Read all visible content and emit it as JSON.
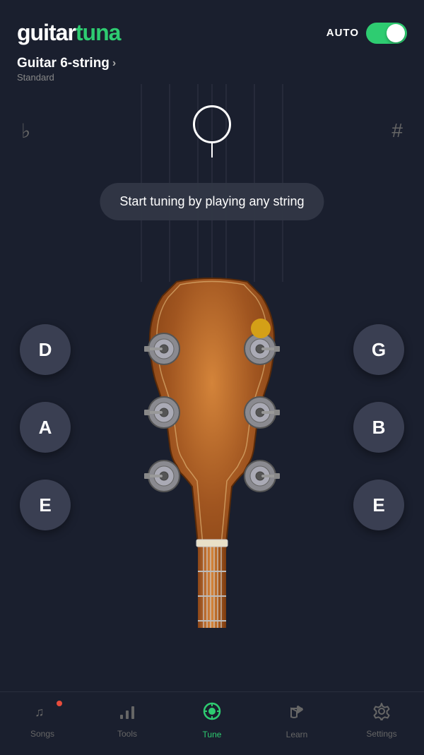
{
  "app": {
    "logo_guitar": "guitar",
    "logo_tuna": "tuna",
    "auto_label": "AUTO",
    "toggle_state": true
  },
  "instrument": {
    "name": "Guitar 6-string",
    "tuning": "Standard",
    "chevron": "›"
  },
  "tuner": {
    "flat_symbol": "♭",
    "sharp_symbol": "#",
    "tooltip": "Start tuning by playing any string"
  },
  "strings": [
    {
      "note": "D",
      "position": "left-top"
    },
    {
      "note": "A",
      "position": "left-mid"
    },
    {
      "note": "E",
      "position": "left-bot"
    },
    {
      "note": "G",
      "position": "right-top"
    },
    {
      "note": "B",
      "position": "right-mid"
    },
    {
      "note": "E",
      "position": "right-bot"
    }
  ],
  "nav": {
    "items": [
      {
        "id": "songs",
        "label": "Songs",
        "icon": "♩♫",
        "active": false,
        "has_dot": true
      },
      {
        "id": "tools",
        "label": "Tools",
        "icon": "bar_chart",
        "active": false,
        "has_dot": false
      },
      {
        "id": "tune",
        "label": "Tune",
        "icon": "tune",
        "active": true,
        "has_dot": false
      },
      {
        "id": "learn",
        "label": "Learn",
        "icon": "learn",
        "active": false,
        "has_dot": false
      },
      {
        "id": "settings",
        "label": "Settings",
        "icon": "gear",
        "active": false,
        "has_dot": false
      }
    ]
  }
}
